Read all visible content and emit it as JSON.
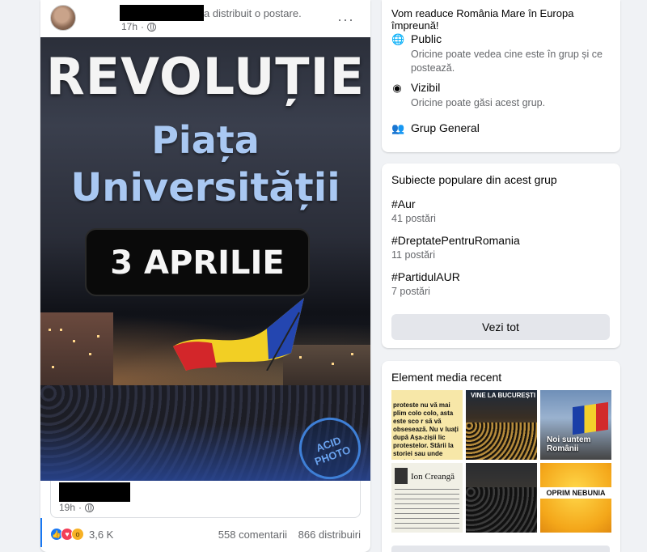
{
  "post": {
    "author_suffix": "a distribuit o postare.",
    "time": "17h",
    "more": "···",
    "poster": {
      "title": "REVOLUȚIE",
      "line1": "Piața",
      "line2": "Universității",
      "date": "3 APRILIE",
      "watermark": "ACID PHOTO"
    },
    "shared": {
      "time": "19h"
    },
    "reactions": {
      "count": "3,6 K",
      "comments": "558 comentarii",
      "shares": "866 distribuiri"
    }
  },
  "about": {
    "description": "Vom readuce România Mare în Europa împreună!",
    "items": [
      {
        "icon": "globe-icon",
        "title": "Public",
        "sub": "Oricine poate vedea cine este în grup și ce postează."
      },
      {
        "icon": "eye-icon",
        "title": "Vizibil",
        "sub": "Oricine poate găsi acest grup."
      },
      {
        "icon": "people-icon",
        "title": "Grup General",
        "sub": ""
      }
    ]
  },
  "topics": {
    "title": "Subiecte populare din acest grup",
    "items": [
      {
        "tag": "#Aur",
        "count": "41 postări"
      },
      {
        "tag": "#DreptatePentruRomania",
        "count": "11 postări"
      },
      {
        "tag": "#PartidulAUR",
        "count": "7 postări"
      }
    ],
    "see_all": "Vezi tot"
  },
  "media": {
    "title": "Element media recent",
    "tiles": [
      {
        "text": "proteste nu vă mai plim colo colo, asta este sco r să vă obsesează. Nu v luați după Așa-zișii lic protestelor. Stării la storiei sau unde protest"
      },
      {
        "text": "VINE LA BUCUREȘTI"
      },
      {
        "text": "Noi suntem Românii"
      },
      {
        "text": "Ion Creangă"
      },
      {
        "text": ""
      },
      {
        "text": "OPRIM NEBUNIA"
      }
    ]
  }
}
